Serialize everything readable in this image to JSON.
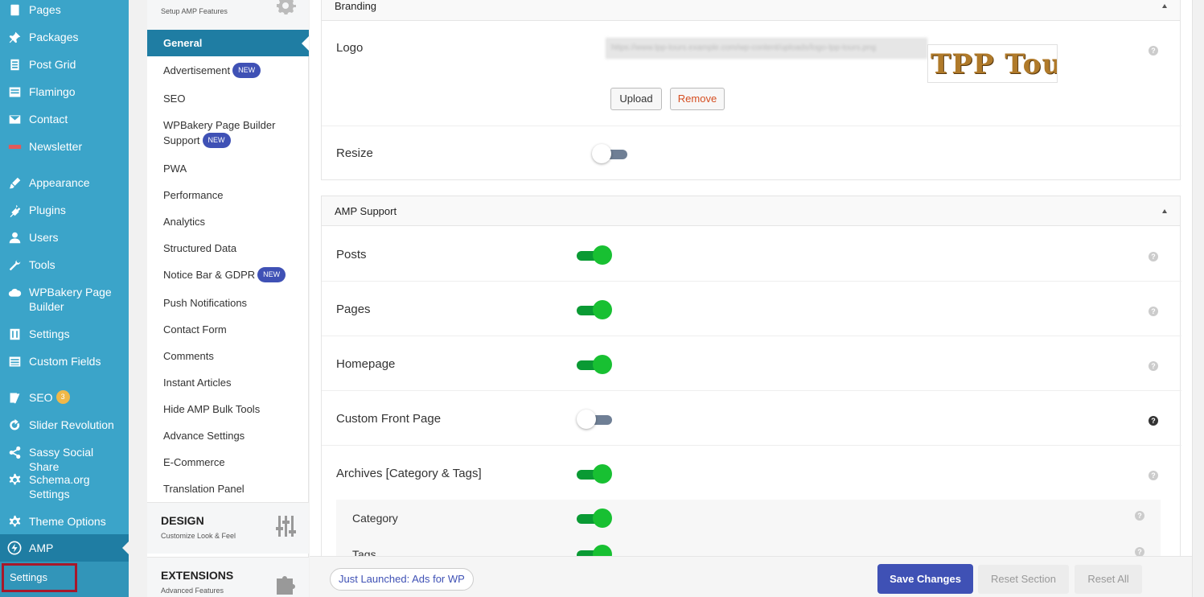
{
  "wp_menu": {
    "items": [
      {
        "label": "Pages",
        "icon": "pages-icon"
      },
      {
        "label": "Packages",
        "icon": "pin-icon"
      },
      {
        "label": "Post Grid",
        "icon": "grid-icon"
      },
      {
        "label": "Flamingo",
        "icon": "flamingo-icon"
      },
      {
        "label": "Contact",
        "icon": "mail-icon"
      },
      {
        "label": "Newsletter",
        "icon": "newsletter-icon"
      },
      {
        "label": "Appearance",
        "icon": "brush-icon"
      },
      {
        "label": "Plugins",
        "icon": "plug-icon"
      },
      {
        "label": "Users",
        "icon": "user-icon"
      },
      {
        "label": "Tools",
        "icon": "wrench-icon"
      },
      {
        "label": "WPBakery Page Builder",
        "icon": "cloud-icon"
      },
      {
        "label": "Settings",
        "icon": "sliders-icon"
      },
      {
        "label": "Custom Fields",
        "icon": "table-icon"
      },
      {
        "label": "SEO",
        "icon": "yoast-icon",
        "badge": "3"
      },
      {
        "label": "Slider Revolution",
        "icon": "refresh-icon"
      },
      {
        "label": "Sassy Social Share",
        "icon": "share-icon"
      },
      {
        "label": "Schema.org Settings",
        "icon": "gear-icon"
      },
      {
        "label": "Theme Options",
        "icon": "gear-icon"
      }
    ],
    "active": {
      "label": "AMP",
      "icon": "lightning-icon"
    },
    "submenu_settings": "Settings"
  },
  "amp_nav": {
    "setup_subtitle": "Setup AMP Features",
    "items": [
      {
        "label": "General"
      },
      {
        "label": "Advertisement",
        "badge": "NEW"
      },
      {
        "label": "SEO"
      },
      {
        "label": "WPBakery Page Builder Support",
        "badge": "NEW"
      },
      {
        "label": "PWA"
      },
      {
        "label": "Performance"
      },
      {
        "label": "Analytics"
      },
      {
        "label": "Structured Data"
      },
      {
        "label": "Notice Bar & GDPR",
        "badge": "NEW"
      },
      {
        "label": "Push Notifications"
      },
      {
        "label": "Contact Form"
      },
      {
        "label": "Comments"
      },
      {
        "label": "Instant Articles"
      },
      {
        "label": "Hide AMP Bulk Tools"
      },
      {
        "label": "Advance Settings"
      },
      {
        "label": "E-Commerce"
      },
      {
        "label": "Translation Panel"
      }
    ],
    "design": {
      "title": "DESIGN",
      "subtitle": "Customize Look & Feel"
    },
    "extensions": {
      "title": "EXTENSIONS",
      "subtitle": "Advanced Features"
    }
  },
  "branding": {
    "title": "Branding",
    "logo_label": "Logo",
    "logo_url": "https://www.tpp-tours.example.com/wp-content/uploads/logo-tpp-tours.png",
    "logo_preview_text": "TPP Tour",
    "upload_label": "Upload",
    "remove_label": "Remove",
    "resize_label": "Resize",
    "resize_on": false
  },
  "amp_support": {
    "title": "AMP Support",
    "rows": [
      {
        "label": "Posts",
        "on": true
      },
      {
        "label": "Pages",
        "on": true
      },
      {
        "label": "Homepage",
        "on": true
      },
      {
        "label": "Custom Front Page",
        "on": false
      },
      {
        "label": "Archives [Category & Tags]",
        "on": true
      }
    ],
    "subrows": [
      {
        "label": "Category",
        "on": true
      },
      {
        "label": "Tags",
        "on": true
      }
    ]
  },
  "footer": {
    "ads_link": "Just Launched: Ads for WP",
    "save": "Save Changes",
    "reset_section": "Reset Section",
    "reset_all": "Reset All"
  },
  "colors": {
    "wp_sidebar": "#3ba4c9",
    "wp_active": "#1f7da3",
    "toggle_on": "#18c032",
    "toggle_off_track": "#6f7f95",
    "primary_button": "#3f51b5",
    "new_badge": "#3f51b5",
    "highlight_box": "#a8182a"
  }
}
